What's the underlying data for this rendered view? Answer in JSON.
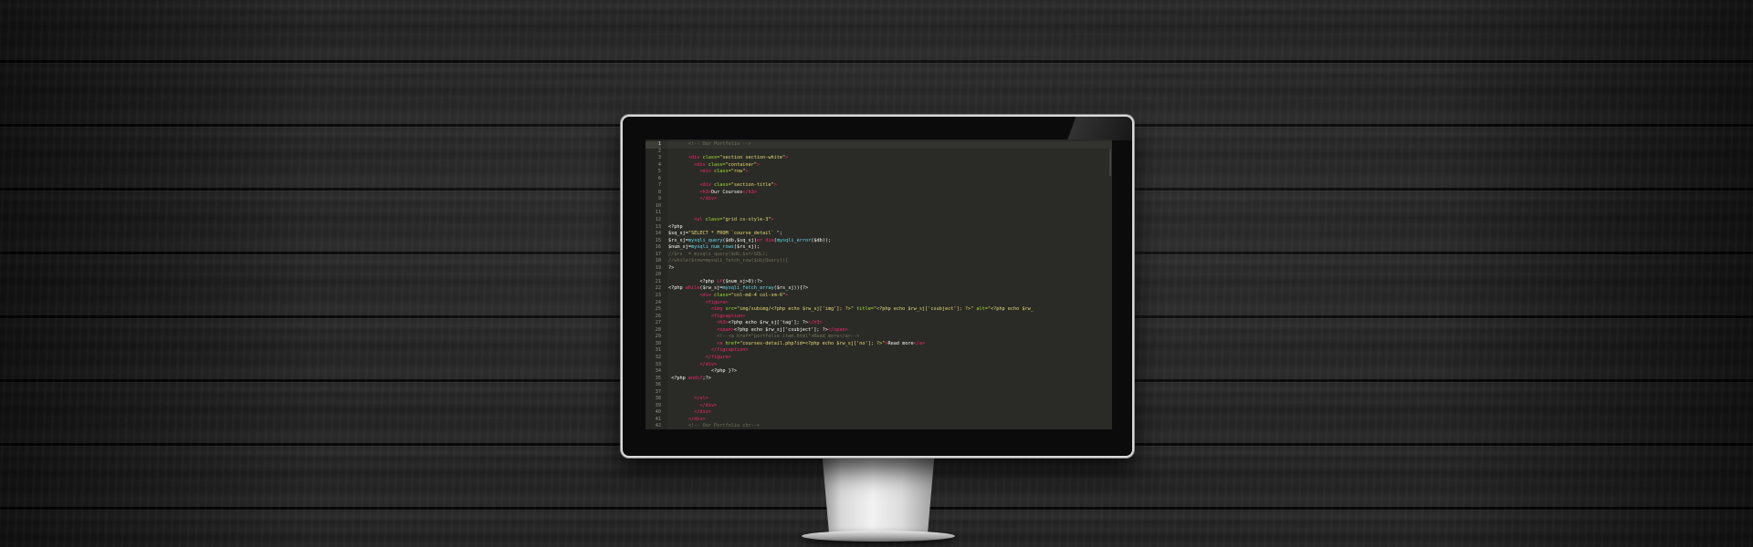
{
  "editor": {
    "theme_colors": {
      "background": "#2a2b26",
      "tag": "#f92672",
      "attribute": "#a6e22e",
      "string": "#e6db74",
      "function": "#66d9ef",
      "comment": "#75715e"
    },
    "active_line": 1,
    "lines": [
      {
        "n": "1",
        "indent": "       ",
        "t": [
          {
            "c": "cm",
            "v": "<!-- Our Portfolio -->"
          }
        ]
      },
      {
        "n": "2",
        "indent": "",
        "t": []
      },
      {
        "n": "3",
        "indent": "       ",
        "t": [
          {
            "c": "tag",
            "v": "<div "
          },
          {
            "c": "attr",
            "v": "class="
          },
          {
            "c": "str",
            "v": "\"section section-white\""
          },
          {
            "c": "tag",
            "v": ">"
          }
        ]
      },
      {
        "n": "4",
        "indent": "         ",
        "t": [
          {
            "c": "tag",
            "v": "<div "
          },
          {
            "c": "attr",
            "v": "class="
          },
          {
            "c": "str",
            "v": "\"container\""
          },
          {
            "c": "tag",
            "v": ">"
          }
        ]
      },
      {
        "n": "5",
        "indent": "           ",
        "t": [
          {
            "c": "tag",
            "v": "<div "
          },
          {
            "c": "attr",
            "v": "class="
          },
          {
            "c": "str",
            "v": "\"row\""
          },
          {
            "c": "tag",
            "v": ">"
          }
        ]
      },
      {
        "n": "6",
        "indent": "",
        "t": []
      },
      {
        "n": "7",
        "indent": "           ",
        "t": [
          {
            "c": "tag",
            "v": "<div "
          },
          {
            "c": "attr",
            "v": "class="
          },
          {
            "c": "str",
            "v": "\"section-title\""
          },
          {
            "c": "tag",
            "v": ">"
          }
        ]
      },
      {
        "n": "8",
        "indent": "           ",
        "t": [
          {
            "c": "tag",
            "v": "<h3>"
          },
          {
            "c": "txt",
            "v": "Our Courses"
          },
          {
            "c": "tag",
            "v": "</h3>"
          }
        ]
      },
      {
        "n": "9",
        "indent": "           ",
        "t": [
          {
            "c": "tag",
            "v": "</div>"
          }
        ]
      },
      {
        "n": "10",
        "indent": "",
        "t": []
      },
      {
        "n": "11",
        "indent": "",
        "t": []
      },
      {
        "n": "12",
        "indent": "         ",
        "t": [
          {
            "c": "tag",
            "v": "<ul "
          },
          {
            "c": "attr",
            "v": "class="
          },
          {
            "c": "str",
            "v": "\"grid cs-style-3\""
          },
          {
            "c": "tag",
            "v": ">"
          }
        ]
      },
      {
        "n": "13",
        "indent": "",
        "t": [
          {
            "c": "txt",
            "v": "<?php"
          }
        ]
      },
      {
        "n": "14",
        "indent": "",
        "t": [
          {
            "c": "txt",
            "v": "$sq_sj="
          },
          {
            "c": "str",
            "v": "\"SELECT * FROM `course_detail` \""
          },
          {
            "c": "txt",
            "v": ";"
          }
        ]
      },
      {
        "n": "15",
        "indent": "",
        "t": [
          {
            "c": "txt",
            "v": "$rs_sj="
          },
          {
            "c": "fn",
            "v": "mysqli_query"
          },
          {
            "c": "txt",
            "v": "($db,$sq_sj)"
          },
          {
            "c": "kw",
            "v": "or die"
          },
          {
            "c": "txt",
            "v": "("
          },
          {
            "c": "fn",
            "v": "mysqli_error"
          },
          {
            "c": "txt",
            "v": "($db));"
          }
        ]
      },
      {
        "n": "16",
        "indent": "",
        "t": [
          {
            "c": "txt",
            "v": "$num_sj="
          },
          {
            "c": "fn",
            "v": "mysqli_num_rows"
          },
          {
            "c": "txt",
            "v": "($rs_sj);"
          }
        ]
      },
      {
        "n": "17",
        "indent": "",
        "t": [
          {
            "c": "cm",
            "v": "//$rs  = mysqli_query($db,$strSQL);"
          }
        ]
      },
      {
        "n": "18",
        "indent": "",
        "t": [
          {
            "c": "cm",
            "v": "//while($row=mysqli_fetch_row($objQuery)){"
          }
        ]
      },
      {
        "n": "19",
        "indent": "",
        "t": [
          {
            "c": "txt",
            "v": "?>"
          }
        ]
      },
      {
        "n": "20",
        "indent": "",
        "t": []
      },
      {
        "n": "21",
        "indent": "           ",
        "t": [
          {
            "c": "txt",
            "v": "<?php "
          },
          {
            "c": "kw",
            "v": "if"
          },
          {
            "c": "txt",
            "v": "($num_sj>0):?>"
          }
        ]
      },
      {
        "n": "22",
        "indent": "",
        "t": [
          {
            "c": "txt",
            "v": "<?php "
          },
          {
            "c": "kw",
            "v": "while"
          },
          {
            "c": "txt",
            "v": "($rw_sj="
          },
          {
            "c": "fn",
            "v": "mysqli_fetch_array"
          },
          {
            "c": "txt",
            "v": "($rs_sj)){?>"
          }
        ]
      },
      {
        "n": "23",
        "indent": "           ",
        "t": [
          {
            "c": "tag",
            "v": "<div "
          },
          {
            "c": "attr",
            "v": "class="
          },
          {
            "c": "str",
            "v": "\"col-md-4 col-sm-6\""
          },
          {
            "c": "tag",
            "v": ">"
          }
        ]
      },
      {
        "n": "24",
        "indent": "             ",
        "t": [
          {
            "c": "tag",
            "v": "<figure>"
          }
        ]
      },
      {
        "n": "25",
        "indent": "               ",
        "t": [
          {
            "c": "tag",
            "v": "<img "
          },
          {
            "c": "attr",
            "v": "src="
          },
          {
            "c": "str",
            "v": "\"img/subimg/<?php echo $rw_sj['img']; ?>\""
          },
          {
            "c": "attr",
            "v": " title="
          },
          {
            "c": "str",
            "v": "\"<?php echo $rw_sj['csubject']; ?>\""
          },
          {
            "c": "attr",
            "v": " alt="
          },
          {
            "c": "str",
            "v": "\"<?php echo $rw_"
          }
        ]
      },
      {
        "n": "26",
        "indent": "               ",
        "t": [
          {
            "c": "tag",
            "v": "<figcaption>"
          }
        ]
      },
      {
        "n": "27",
        "indent": "                 ",
        "t": [
          {
            "c": "tag",
            "v": "<h3>"
          },
          {
            "c": "txt",
            "v": "<?php echo $rw_sj['tag']; ?>"
          },
          {
            "c": "tag",
            "v": "</h3>"
          }
        ]
      },
      {
        "n": "28",
        "indent": "                 ",
        "t": [
          {
            "c": "tag",
            "v": "<span>"
          },
          {
            "c": "txt",
            "v": "<?php echo $rw_sj['csubject']; ?>"
          },
          {
            "c": "tag",
            "v": "</span>"
          }
        ]
      },
      {
        "n": "29",
        "indent": "                 ",
        "t": [
          {
            "c": "cm",
            "v": "<!--<a href=\"portfolio-item.html\">Read more</a>-->"
          }
        ]
      },
      {
        "n": "30",
        "indent": "                 ",
        "t": [
          {
            "c": "tag",
            "v": "<a "
          },
          {
            "c": "attr",
            "v": "href="
          },
          {
            "c": "str",
            "v": "\"courses-detail.php?id=<?php echo $rw_sj['no']; ?>\""
          },
          {
            "c": "tag",
            "v": ">"
          },
          {
            "c": "txt",
            "v": "Read more"
          },
          {
            "c": "tag",
            "v": "</a>"
          }
        ]
      },
      {
        "n": "31",
        "indent": "               ",
        "t": [
          {
            "c": "tag",
            "v": "</figcaption>"
          }
        ]
      },
      {
        "n": "32",
        "indent": "             ",
        "t": [
          {
            "c": "tag",
            "v": "</figure>"
          }
        ]
      },
      {
        "n": "33",
        "indent": "           ",
        "t": [
          {
            "c": "tag",
            "v": "</div>"
          }
        ]
      },
      {
        "n": "34",
        "indent": "               ",
        "t": [
          {
            "c": "txt",
            "v": "<?php }?>"
          }
        ]
      },
      {
        "n": "35",
        "indent": " ",
        "t": [
          {
            "c": "txt",
            "v": "<?php "
          },
          {
            "c": "kw",
            "v": "endif"
          },
          {
            "c": "txt",
            "v": ";?>"
          }
        ]
      },
      {
        "n": "36",
        "indent": "",
        "t": []
      },
      {
        "n": "37",
        "indent": "",
        "t": []
      },
      {
        "n": "38",
        "indent": "         ",
        "t": [
          {
            "c": "tag",
            "v": "</ul>"
          }
        ]
      },
      {
        "n": "39",
        "indent": "           ",
        "t": [
          {
            "c": "tag",
            "v": "</div>"
          }
        ]
      },
      {
        "n": "40",
        "indent": "         ",
        "t": [
          {
            "c": "tag",
            "v": "</div>"
          }
        ]
      },
      {
        "n": "41",
        "indent": "       ",
        "t": [
          {
            "c": "tag",
            "v": "</div>"
          }
        ]
      },
      {
        "n": "42",
        "indent": "       ",
        "t": [
          {
            "c": "cm",
            "v": "<!-- Our Portfolio chr-->"
          }
        ]
      }
    ]
  }
}
